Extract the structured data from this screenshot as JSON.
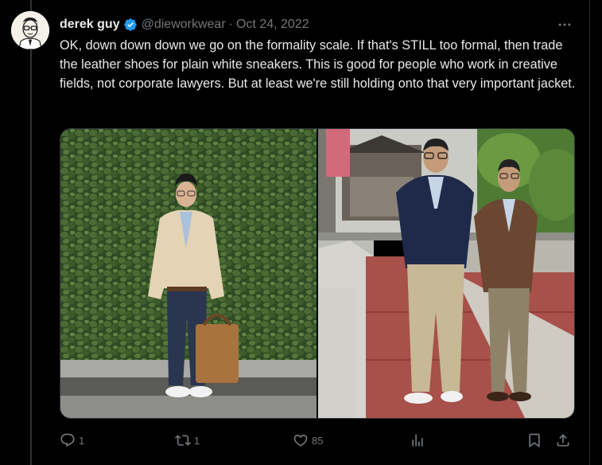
{
  "tweet": {
    "author": {
      "display_name": "derek guy",
      "handle": "@dieworkwear",
      "verified": true,
      "avatar_icon": "illustrated-portrait-avatar"
    },
    "separator": "·",
    "date": "Oct 24, 2022",
    "text": "OK, down down down we go on the formality scale. If that's STILL too formal, then trade the leather shoes for plain white sneakers. This is good for people who work in creative fields, not corporate lawyers. But at least we're still holding onto that very important jacket.",
    "media": [
      {
        "kind": "photo",
        "icon": "photo-man-beige-jacket-ivy-wall"
      },
      {
        "kind": "photo",
        "icon": "photo-two-men-jackets-street"
      }
    ],
    "actions": {
      "reply": {
        "icon": "reply-icon",
        "count": "1"
      },
      "retweet": {
        "icon": "retweet-icon",
        "count": "1"
      },
      "like": {
        "icon": "heart-icon",
        "count": "85"
      },
      "views": {
        "icon": "analytics-icon",
        "count": ""
      },
      "bookmark": {
        "icon": "bookmark-icon"
      },
      "share": {
        "icon": "share-icon"
      }
    }
  },
  "colors": {
    "background": "#000000",
    "text_primary": "#e7e9ea",
    "text_secondary": "#71767b",
    "verified_blue": "#1d9bf0",
    "border": "#2f3336"
  }
}
